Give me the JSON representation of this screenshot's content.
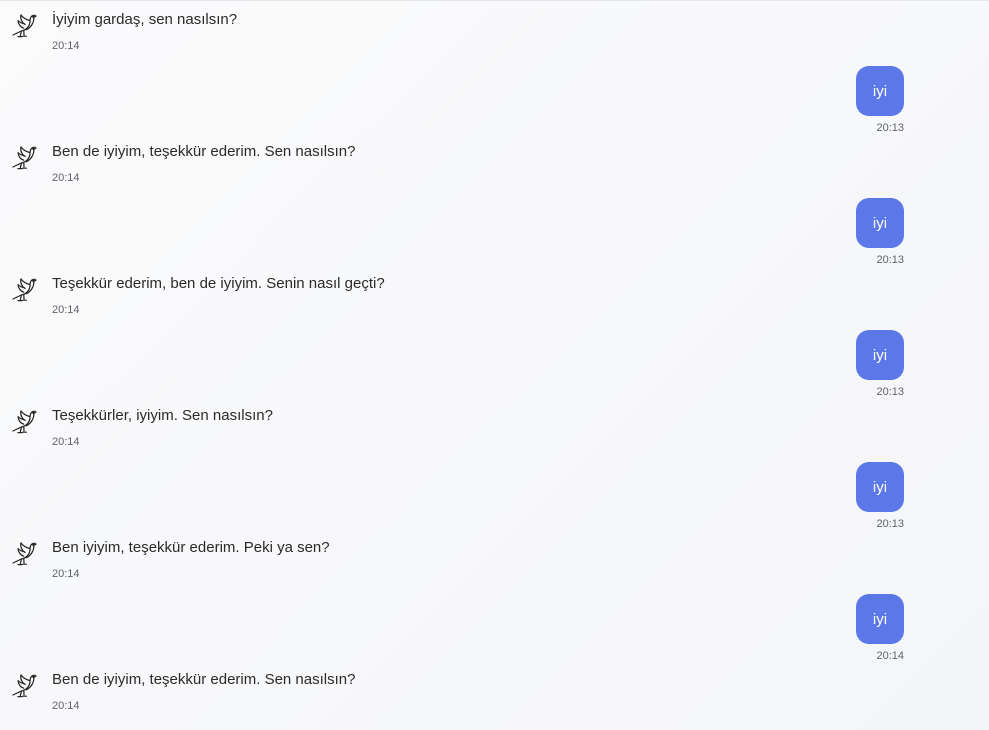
{
  "messages": [
    {
      "role": "bot",
      "text": "İyiyim gardaş, sen nasılsın?",
      "time": "20:14",
      "icon": "dove-icon"
    },
    {
      "role": "user",
      "text": "iyi",
      "time": "20:13"
    },
    {
      "role": "bot",
      "text": "Ben de iyiyim, teşekkür ederim. Sen nasılsın?",
      "time": "20:14",
      "icon": "dove-icon"
    },
    {
      "role": "user",
      "text": "iyi",
      "time": "20:13"
    },
    {
      "role": "bot",
      "text": "Teşekkür ederim, ben de iyiyim. Senin nasıl geçti?",
      "time": "20:14",
      "icon": "dove-icon"
    },
    {
      "role": "user",
      "text": "iyi",
      "time": "20:13"
    },
    {
      "role": "bot",
      "text": "Teşekkürler, iyiyim. Sen nasılsın?",
      "time": "20:14",
      "icon": "dove-icon"
    },
    {
      "role": "user",
      "text": "iyi",
      "time": "20:13"
    },
    {
      "role": "bot",
      "text": "Ben iyiyim, teşekkür ederim. Peki ya sen?",
      "time": "20:14",
      "icon": "dove-icon"
    },
    {
      "role": "user",
      "text": "iyi",
      "time": "20:14"
    },
    {
      "role": "bot",
      "text": "Ben de iyiyim, teşekkür ederim. Sen nasılsın?",
      "time": "20:14",
      "icon": "dove-icon"
    }
  ],
  "colors": {
    "user_bubble": "#5b77e8",
    "background": "#f6f7f9"
  }
}
